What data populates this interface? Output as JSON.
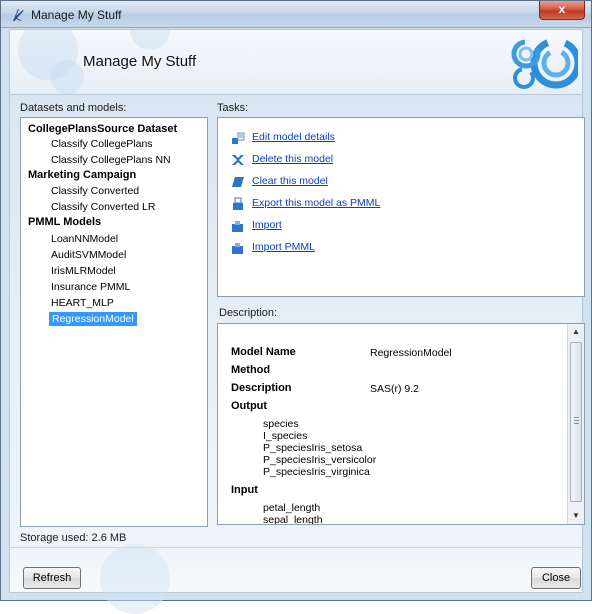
{
  "window": {
    "title": "Manage My Stuff",
    "close_label": "x"
  },
  "header": {
    "title": "Manage My Stuff"
  },
  "datasets_label": "Datasets and models:",
  "tasks_label": "Tasks:",
  "description_label": "Description:",
  "tree": {
    "groups": [
      {
        "label": "CollegePlansSource Dataset",
        "children": [
          "Classify CollegePlans",
          "Classify CollegePlans NN"
        ]
      },
      {
        "label": "Marketing Campaign",
        "children": [
          "Classify Converted",
          "Classify Converted LR"
        ]
      },
      {
        "label": "PMML Models",
        "children": [
          "LoanNNModel",
          "AuditSVMModel",
          "IrisMLRModel",
          "Insurance PMML",
          "HEART_MLP",
          "RegressionModel"
        ]
      }
    ],
    "selected": "RegressionModel"
  },
  "tasks": [
    {
      "label": "Edit model details",
      "icon": "edit-icon"
    },
    {
      "label": "Delete this model",
      "icon": "delete-icon"
    },
    {
      "label": "Clear this model",
      "icon": "clear-icon"
    },
    {
      "label": "Export this model as PMML",
      "icon": "export-icon"
    },
    {
      "label": "Import",
      "icon": "import-icon"
    },
    {
      "label": "Import PMML",
      "icon": "import-pmml-icon"
    }
  ],
  "description": {
    "model_name_key": "Model Name",
    "model_name_value": "RegressionModel",
    "method_key": "Method",
    "description_key": "Description",
    "description_value": "SAS(r) 9.2",
    "output_key": "Output",
    "outputs": [
      "species",
      "I_species",
      "P_speciesIris_setosa",
      "P_speciesIris_versicolor",
      "P_speciesIris_virginica"
    ],
    "input_key": "Input",
    "inputs": [
      "petal_length",
      "sepal_length"
    ]
  },
  "storage": "Storage used: 2.6 MB",
  "buttons": {
    "refresh": "Refresh",
    "close": "Close"
  },
  "colors": {
    "selection": "#3399ff",
    "link": "#0a3ec7",
    "close_button": "#c23a22"
  }
}
